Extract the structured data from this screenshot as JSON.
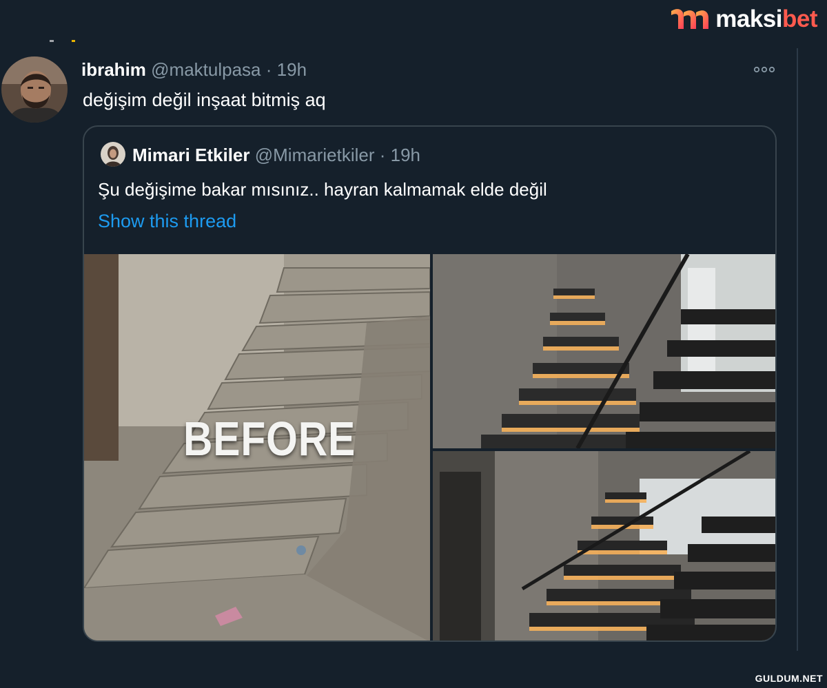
{
  "watermark": {
    "brand_part1": "maksi",
    "brand_part2": "bet",
    "footer": "GULDUM.NET"
  },
  "tweet": {
    "name": "ibrahim",
    "handle": "@maktulpasa",
    "separator": "·",
    "time": "19h",
    "text": "değişim değil inşaat bitmiş aq",
    "more_icon": "more-horizontal-icon"
  },
  "quoted": {
    "name": "Mimari Etkiler",
    "handle": "@Mimarietkiler",
    "separator": "·",
    "time": "19h",
    "text": "Şu değişime bakar mısınız.. hayran kalmamak elde değil",
    "link": "Show this thread",
    "before_label": "BEFORE"
  },
  "colors": {
    "background": "#15202b",
    "secondary_text": "#8899a6",
    "link": "#1d9bf0",
    "card_border": "#38444d",
    "brand_accent": "#ff5a4e"
  }
}
